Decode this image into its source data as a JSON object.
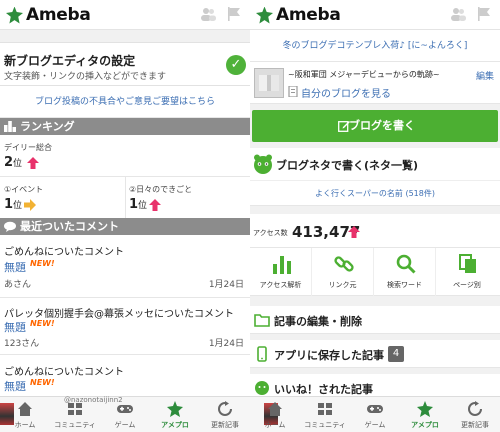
{
  "brand": {
    "name": "Ameba"
  },
  "left": {
    "settings": {
      "title": "新ブログエディタの設定",
      "subtitle": "文字装飾・リンクの挿入などができます"
    },
    "feedback_link": "ブログ投稿の不具合やご意見ご要望はこちら",
    "ranking": {
      "heading": "ランキング",
      "daily_label": "デイリー総合",
      "daily_rank": "2",
      "event_label": "①イベント",
      "event_rank": "1",
      "daily_life_label": "②日々のできごと",
      "daily_life_rank": "1",
      "rank_suffix": "位"
    },
    "comments": {
      "heading": "最近ついたコメント",
      "items": [
        {
          "title": "ごめんねについたコメント",
          "link": "無題",
          "badge": "NEW!",
          "user": "あさん",
          "date": "1月24日"
        },
        {
          "title": "パレッタ個別握手会@幕張メッセについたコメント",
          "link": "無題",
          "badge": "NEW!",
          "user": "123さん",
          "date": "1月24日"
        },
        {
          "title": "ごめんねについたコメント",
          "link": "無題",
          "badge": "NEW!",
          "user": "",
          "date": ""
        }
      ]
    },
    "handle": "@nazonotaijinn2"
  },
  "right": {
    "promo_link": "冬のブログデコテンプレ入荷♪ [に~よんろく]",
    "blog": {
      "name": "~阪和軍団 メジャーデビューからの軌跡~",
      "edit_label": "編集",
      "view_label": "自分のブログを見る"
    },
    "write_button": "ブログを書く",
    "neta": {
      "label": "ブログネタで書く(ネタ一覧)",
      "link": "よく行くスーパーの名前 (518件)"
    },
    "access": {
      "label": "アクセス数",
      "value": "413,477"
    },
    "tools": [
      {
        "icon": "bar-chart-icon",
        "label": "アクセス解析"
      },
      {
        "icon": "link-icon",
        "label": "リンク元"
      },
      {
        "icon": "search-icon",
        "label": "検索ワード"
      },
      {
        "icon": "pages-icon",
        "label": "ページ別"
      }
    ],
    "menu": {
      "edit_articles": "記事の編集・削除",
      "saved_articles": "アプリに保存した記事",
      "saved_count": "4",
      "liked_articles": "いいね！された記事"
    }
  },
  "tabbar": {
    "tabs": [
      {
        "label": "ホーム"
      },
      {
        "label": "コミュニティ"
      },
      {
        "label": "ゲーム"
      },
      {
        "label": "アメプロ"
      },
      {
        "label": "更新記事"
      }
    ]
  },
  "colors": {
    "accent_green": "#4caf32",
    "link_blue": "#3d6fb3",
    "new_orange": "#ff6600",
    "up_arrow_pink": "#e8326b",
    "flat_arrow_yellow": "#f2b233"
  }
}
